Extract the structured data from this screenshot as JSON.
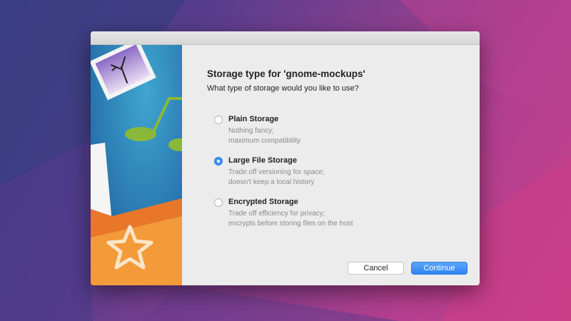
{
  "dialog": {
    "title": "Storage type for 'gnome-mockups'",
    "subtitle": "What type of storage would you like to use?",
    "options": [
      {
        "label": "Plain Storage",
        "desc1": "Nothing fancy;",
        "desc2": "maximum compatibility",
        "selected": false
      },
      {
        "label": "Large File Storage",
        "desc1": "Trade off versioning for space;",
        "desc2": "doesn't keep a local history",
        "selected": true
      },
      {
        "label": "Encrypted Storage",
        "desc1": "Trade off efficiency for privacy;",
        "desc2": "encrypts before storing files on the host",
        "selected": false
      }
    ],
    "cancel_label": "Cancel",
    "continue_label": "Continue"
  },
  "colors": {
    "accent": "#3d8ff5"
  }
}
